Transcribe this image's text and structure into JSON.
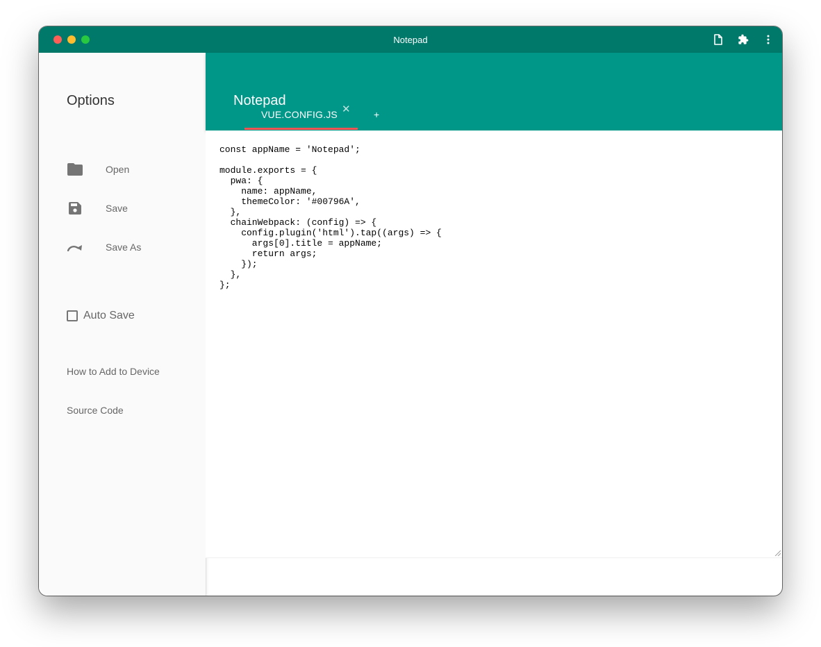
{
  "window": {
    "title": "Notepad",
    "titlebar_color": "#00796A",
    "header_color": "#009688",
    "tab_indicator_color": "#FF5252"
  },
  "titlebar_icons": [
    "new-file-icon",
    "extension-puzzle-icon",
    "more-vert-icon"
  ],
  "sidebar": {
    "title": "Options",
    "items": [
      {
        "label": "Open",
        "icon": "folder-icon"
      },
      {
        "label": "Save",
        "icon": "save-icon"
      },
      {
        "label": "Save As",
        "icon": "redo-icon"
      }
    ],
    "auto_save": {
      "label": "Auto Save",
      "checked": false
    },
    "links": [
      {
        "label": "How to Add to Device"
      },
      {
        "label": "Source Code"
      }
    ]
  },
  "header": {
    "title": "Notepad",
    "tabs": [
      {
        "label": "VUE.CONFIG.JS",
        "active": true,
        "close": "✕"
      }
    ],
    "add_tab": "+"
  },
  "editor": {
    "content": "const appName = 'Notepad';\n\nmodule.exports = {\n  pwa: {\n    name: appName,\n    themeColor: '#00796A',\n  },\n  chainWebpack: (config) => {\n    config.plugin('html').tap((args) => {\n      args[0].title = appName;\n      return args;\n    });\n  },\n};"
  }
}
